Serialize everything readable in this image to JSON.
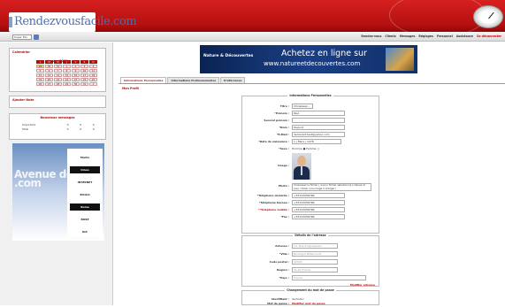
{
  "header": {
    "logo": "Rendezvousfacile.com"
  },
  "nav": {
    "select": "Super Fan",
    "links": [
      "Rendez-vous",
      "Clients",
      "Messages",
      "Réglages",
      "Personnel",
      "Assistance",
      "Se déconnecter"
    ]
  },
  "sidebar": {
    "calendar_title": "Calendrier",
    "month": "Janvier 2009",
    "days": [
      "L",
      "M",
      "M",
      "J",
      "V",
      "S",
      "D"
    ],
    "dates": [
      "29",
      "30",
      "31",
      "1",
      "2",
      "3",
      "4",
      "5",
      "6",
      "7",
      "8",
      "9",
      "10",
      "11",
      "12",
      "13",
      "14",
      "15",
      "16",
      "17",
      "18",
      "19",
      "20",
      "21",
      "22",
      "23",
      "24",
      "25",
      "26",
      "27",
      "28",
      "29",
      "30",
      "31",
      "1"
    ],
    "add_note": "Ajouter Note",
    "new_messages": "Nouveaux messages",
    "msg_rows": [
      {
        "label": "Important",
        "a": "0",
        "b": "0",
        "c": "0"
      },
      {
        "label": "Total",
        "a": "0",
        "b": "0",
        "c": "0"
      }
    ],
    "ad": {
      "text": "Avenue de Club .com",
      "brands": [
        "Marks",
        "Cineo",
        "INTERNET",
        "Bristol",
        "Rome",
        "BOSE",
        "KIA"
      ]
    }
  },
  "banner": {
    "brand": "Nature & Découvertes",
    "headline": "Achetez en ligne sur",
    "url": "www.natureetdecouvertes.com"
  },
  "tabs": [
    "Informations Personnelles",
    "Informations Professionnelles",
    "Préférences"
  ],
  "main_title": "Mon Profil",
  "personal": {
    "legend": "Informations Personnelles",
    "fields": [
      {
        "label": "Titre :",
        "value": "Choisissez...",
        "kind": "select"
      },
      {
        "label": "*Prénom :",
        "value": "Paul"
      },
      {
        "label": "Second prénom :",
        "value": ""
      },
      {
        "label": "*Nom :",
        "value": "Dupont"
      },
      {
        "label": "*E-Mail :",
        "value": "demonkit-test@yahoo.com"
      },
      {
        "label": "*Date de naissance :",
        "value": "1 | Mars | 1978"
      },
      {
        "label": "*Sexe :",
        "value": "Homme ● Femme ○",
        "kind": "text"
      },
      {
        "label": "Image :",
        "value": "",
        "kind": "photo"
      },
      {
        "label": "Photo :",
        "value": "Choisissez le fichier | aucun fichier sélectionné (cliquez ici pour choisir une image à charger)",
        "kind": "file"
      },
      {
        "label": "*Téléphone domicile :",
        "value": "+33123456789"
      },
      {
        "label": "*Téléphone bureau :",
        "value": "+33123456789"
      },
      {
        "label": "**Téléphone mobile :",
        "value": "+33123456789"
      },
      {
        "label": "*Fax :",
        "value": "+33123456789"
      }
    ]
  },
  "address": {
    "legend": "Détails de l'adresse",
    "fields": [
      {
        "label": "Adresse :",
        "value": "14, Rue d'Aguesseau",
        "ph": true
      },
      {
        "label": "*Ville :",
        "value": "Boulogne Billancourt",
        "ph": true
      },
      {
        "label": "Code postal :",
        "value": "92100",
        "ph": true
      },
      {
        "label": "Région :",
        "value": "Ile de France",
        "ph": true
      },
      {
        "label": "*Pays :",
        "value": "France",
        "ph": true
      }
    ],
    "link": "Modifier adresse"
  },
  "password": {
    "legend": "Changement du mot de passe",
    "fields": [
      {
        "label": "Identifiant :",
        "value": "demodoc"
      },
      {
        "label": "Mot de passe :",
        "value": "Modifier mot de passe",
        "red": true
      }
    ]
  }
}
